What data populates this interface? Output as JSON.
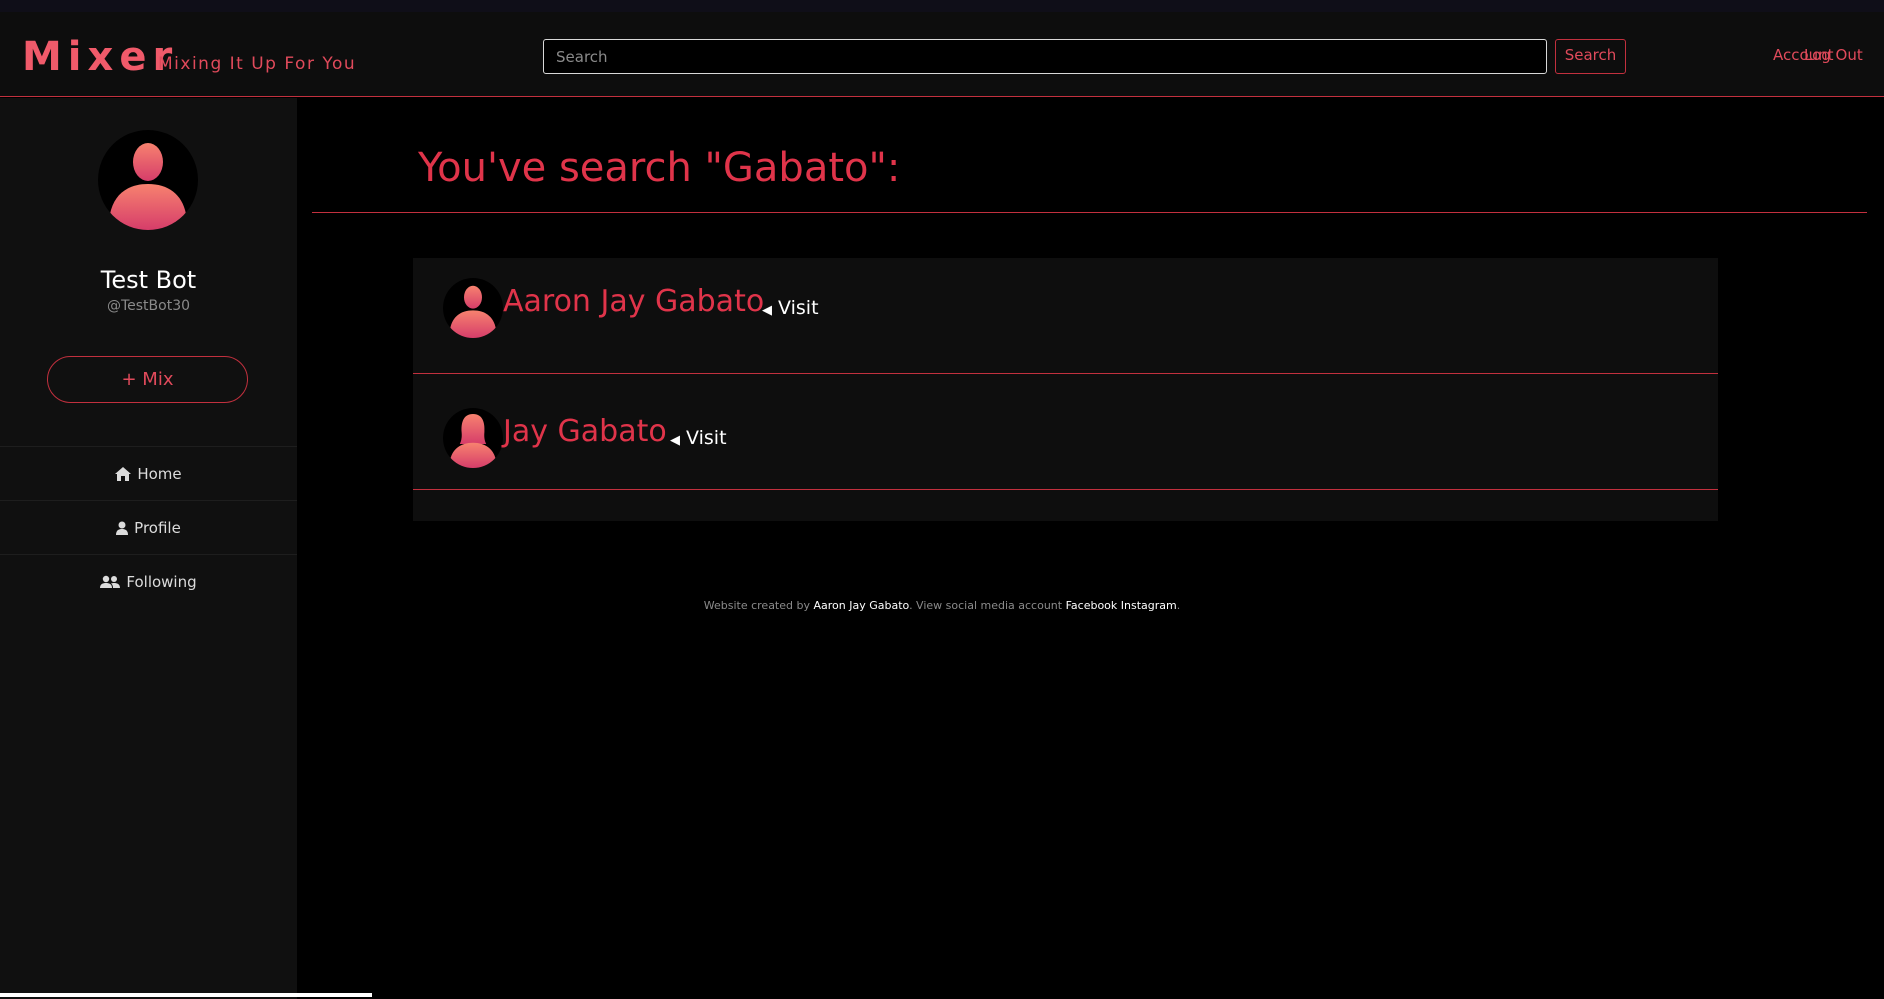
{
  "navbar": {
    "brand": "Mixer",
    "tagline": "Mixing It Up For You",
    "search_placeholder": "Search",
    "search_value": "",
    "search_button": "Search",
    "links": [
      "Account",
      "Log Out"
    ]
  },
  "sidebar": {
    "name": "Test Bot",
    "handle": "@TestBot30",
    "mix_button": "+ Mix",
    "menu": [
      {
        "label": "Home",
        "icon": "home-icon"
      },
      {
        "label": "Profile",
        "icon": "user-icon"
      },
      {
        "label": "Following",
        "icon": "users-icon"
      }
    ]
  },
  "main": {
    "title": "You've search \"Gabato\":",
    "results": [
      {
        "name": "Aaron Jay Gabato",
        "visit": "Visit",
        "avatar": "male-avatar"
      },
      {
        "name": "Jay Gabato",
        "visit": "Visit",
        "avatar": "female-avatar"
      }
    ]
  },
  "footer": {
    "prefix": "Website created by ",
    "author": "Aaron Jay Gabato",
    "middle": ". View social media account ",
    "facebook": "Facebook",
    "instagram": "Instagram",
    "suffix": "."
  },
  "colors": {
    "accent": "#e0344a",
    "accent_border": "#c2303e",
    "navbar_bg": "#0d0d0d",
    "sidebar_bg": "#101010",
    "page_bg": "#000000"
  }
}
